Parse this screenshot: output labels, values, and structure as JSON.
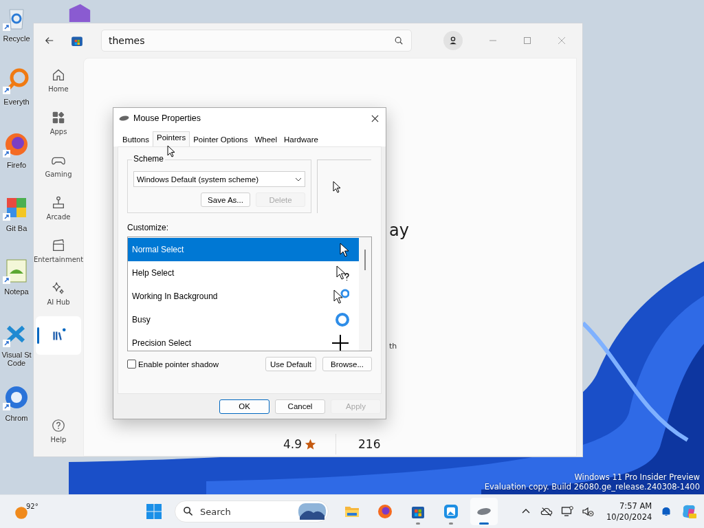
{
  "desktop_icons": [
    {
      "kind": "recycle-bin",
      "label": "Recycle"
    },
    {
      "kind": "search-app",
      "label": "Everyth"
    },
    {
      "kind": "firefox",
      "label": "Firefo"
    },
    {
      "kind": "git",
      "label": "Git Ba"
    },
    {
      "kind": "notepad",
      "label": "Notepa"
    },
    {
      "kind": "vscode",
      "label": "Visual St Code"
    },
    {
      "kind": "chrome",
      "label": "Chrom"
    }
  ],
  "store": {
    "search": {
      "value": "themes"
    },
    "nav": [
      {
        "kind": "home",
        "label": "Home",
        "selected": false
      },
      {
        "kind": "apps",
        "label": "Apps",
        "selected": false
      },
      {
        "kind": "gaming",
        "label": "Gaming",
        "selected": false
      },
      {
        "kind": "arcade",
        "label": "Arcade",
        "selected": false
      },
      {
        "kind": "entertainment",
        "label": "Entertainment",
        "selected": false
      },
      {
        "kind": "ai-hub",
        "label": "AI Hub",
        "selected": false
      },
      {
        "kind": "library",
        "selected": true
      }
    ],
    "help": {
      "label": "Help"
    },
    "content": {
      "heading": "ay",
      "text": "th",
      "rating": "4.9",
      "count": "216"
    }
  },
  "dialog": {
    "title": "Mouse Properties",
    "tabs": [
      {
        "label": "Buttons",
        "selected": false
      },
      {
        "label": "Pointers",
        "selected": true
      },
      {
        "label": "Pointer Options",
        "selected": false
      },
      {
        "label": "Wheel",
        "selected": false
      },
      {
        "label": "Hardware",
        "selected": false
      }
    ],
    "scheme": {
      "label": "Scheme",
      "value": "Windows Default (system scheme)",
      "buttons": [
        {
          "label": "Save As...",
          "disabled": false
        },
        {
          "label": "Delete",
          "disabled": true
        }
      ]
    },
    "customize_label": "Customize:",
    "pointers": [
      {
        "label": "Normal Select",
        "kind": "arrow",
        "selected": true
      },
      {
        "label": "Help Select",
        "kind": "help",
        "selected": false
      },
      {
        "label": "Working In Background",
        "kind": "working",
        "selected": false
      },
      {
        "label": "Busy",
        "kind": "busy",
        "selected": false
      },
      {
        "label": "Precision Select",
        "kind": "cross",
        "selected": false
      }
    ],
    "shadow": {
      "label": "Enable pointer shadow",
      "checked": false
    },
    "list_buttons": [
      {
        "label": "Use Default"
      },
      {
        "label": "Browse..."
      }
    ],
    "footer": [
      {
        "label": "OK",
        "default": true,
        "disabled": false
      },
      {
        "label": "Cancel",
        "default": false,
        "disabled": false
      },
      {
        "label": "Apply",
        "default": false,
        "disabled": true
      }
    ]
  },
  "watermark": [
    "Windows 11 Pro Insider Preview",
    "Evaluation copy. Build 26080.ge_release.240308-1400"
  ],
  "taskbar": {
    "weather": {
      "temperature": "92°"
    },
    "search": {
      "placeholder": "Search"
    },
    "apps": [
      {
        "kind": "file-explorer",
        "running": false,
        "active": false
      },
      {
        "kind": "firefox",
        "running": false,
        "active": false
      },
      {
        "kind": "store",
        "running": true,
        "active": false
      },
      {
        "kind": "photos",
        "running": true,
        "active": false
      },
      {
        "kind": "mouse",
        "running": true,
        "active": true
      }
    ],
    "time": "7:57 AM",
    "date": "10/20/2024"
  }
}
